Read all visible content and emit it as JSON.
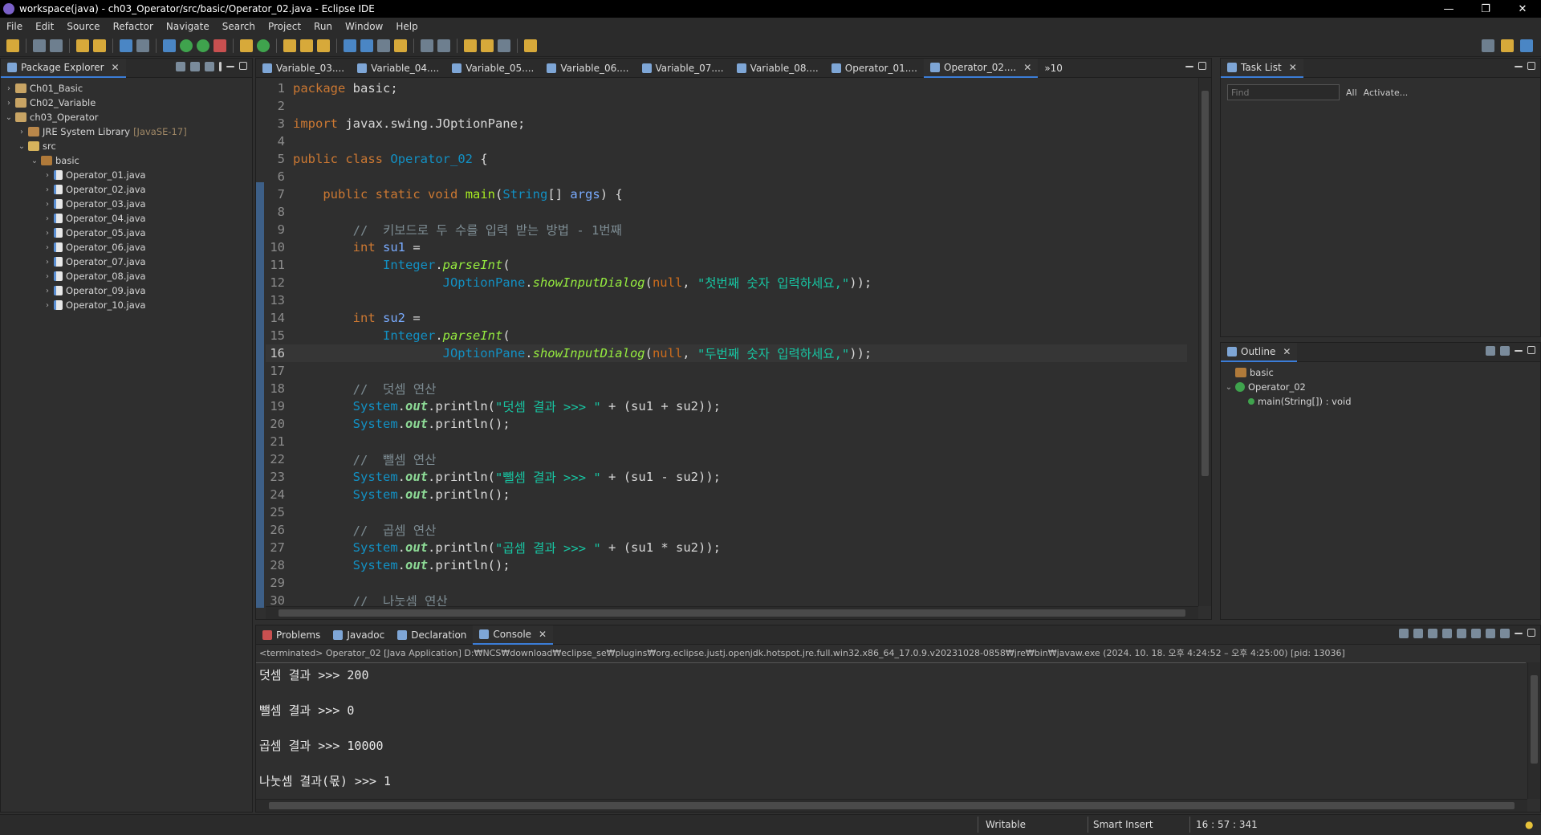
{
  "window": {
    "title": "workspace(java) - ch03_Operator/src/basic/Operator_02.java - Eclipse IDE",
    "minimize": "—",
    "restore": "❐",
    "close": "✕"
  },
  "menu": [
    "File",
    "Edit",
    "Source",
    "Refactor",
    "Navigate",
    "Search",
    "Project",
    "Run",
    "Window",
    "Help"
  ],
  "package_explorer": {
    "title": "Package Explorer",
    "nodes": [
      {
        "label": "Ch01_Basic"
      },
      {
        "label": "Ch02_Variable"
      },
      {
        "label": "ch03_Operator"
      },
      {
        "label": "JRE System Library",
        "suffix": "[JavaSE-17]"
      },
      {
        "label": "src"
      },
      {
        "label": "basic"
      },
      {
        "label": "Operator_01.java"
      },
      {
        "label": "Operator_02.java"
      },
      {
        "label": "Operator_03.java"
      },
      {
        "label": "Operator_04.java"
      },
      {
        "label": "Operator_05.java"
      },
      {
        "label": "Operator_06.java"
      },
      {
        "label": "Operator_07.java"
      },
      {
        "label": "Operator_08.java"
      },
      {
        "label": "Operator_09.java"
      },
      {
        "label": "Operator_10.java"
      }
    ]
  },
  "editor": {
    "tabs": [
      "Variable_03....",
      "Variable_04....",
      "Variable_05....",
      "Variable_06....",
      "Variable_07....",
      "Variable_08....",
      "Operator_01....",
      "Operator_02...."
    ],
    "overflow": "»10",
    "lines": {
      "l1": [
        "package",
        " basic;"
      ],
      "l3": [
        "import",
        " javax.swing.JOptionPane;"
      ],
      "l5": [
        "public",
        " ",
        "class",
        " ",
        "Operator_02",
        " {"
      ],
      "l7": [
        "public",
        " ",
        "static",
        " ",
        "void",
        " ",
        "main",
        "(",
        "String",
        "[] ",
        "args",
        ") {"
      ],
      "l9": "//  키보드로 두 수를 입력 받는 방법 - 1번째",
      "l10": [
        "int",
        " ",
        "su1",
        " ="
      ],
      "l11": [
        "Integer",
        ".",
        "parseInt",
        "("
      ],
      "l12": [
        "JOptionPane",
        ".",
        "showInputDialog",
        "(",
        "null",
        ", ",
        "\"첫번째 숫자 입력하세요,\"",
        "));"
      ],
      "l14": [
        "int",
        " ",
        "su2",
        " ="
      ],
      "l15": [
        "Integer",
        ".",
        "parseInt",
        "("
      ],
      "l16": [
        "JOptionPane",
        ".",
        "showInputDialog",
        "(",
        "null",
        ", ",
        "\"두번째 숫자 입력하세요,\"",
        "));"
      ],
      "l18": "//  덧셈 연산",
      "l19": [
        "System",
        ".",
        "out",
        ".println(",
        "\"덧셈 결과 >>> \"",
        " + (su1 + su2));"
      ],
      "l20": [
        "System",
        ".",
        "out",
        ".println();"
      ],
      "l22": "//  뺄셈 연산",
      "l23": [
        "System",
        ".",
        "out",
        ".println(",
        "\"뺄셈 결과 >>> \"",
        " + (su1 - su2));"
      ],
      "l24": [
        "System",
        ".",
        "out",
        ".println();"
      ],
      "l26": "//  곱셈 연산",
      "l27": [
        "System",
        ".",
        "out",
        ".println(",
        "\"곱셈 결과 >>> \"",
        " + (su1 * su2));"
      ],
      "l28": [
        "System",
        ".",
        "out",
        ".println();"
      ],
      "l30": "//  나눗셈 연산"
    },
    "line_numbers": [
      "1",
      "2",
      "3",
      "4",
      "5",
      "6",
      "7",
      "8",
      "9",
      "10",
      "11",
      "12",
      "13",
      "14",
      "15",
      "16",
      "17",
      "18",
      "19",
      "20",
      "21",
      "22",
      "23",
      "24",
      "25",
      "26",
      "27",
      "28",
      "29",
      "30"
    ]
  },
  "task_list": {
    "title": "Task List",
    "find_placeholder": "Find",
    "all": "All",
    "activate": "Activate..."
  },
  "outline": {
    "title": "Outline",
    "items": [
      "basic",
      "Operator_02",
      "main(String[]) : void"
    ]
  },
  "bottom": {
    "tabs": [
      "Problems",
      "Javadoc",
      "Declaration",
      "Console"
    ],
    "console_header": "<terminated> Operator_02 [Java Application] D:₩NCS₩download₩eclipse_se₩plugins₩org.eclipse.justj.openjdk.hotspot.jre.full.win32.x86_64_17.0.9.v20231028-0858₩jre₩bin₩javaw.exe  (2024. 10. 18. 오후 4:24:52 – 오후 4:25:00) [pid: 13036]",
    "output": [
      "덧셈 결과 >>> 200",
      "",
      "뺄셈 결과 >>> 0",
      "",
      "곱셈 결과 >>> 10000",
      "",
      "나눗셈 결과(몫) >>> 1"
    ]
  },
  "status": {
    "writable": "Writable",
    "insert": "Smart Insert",
    "position": "16 : 57 : 341"
  }
}
